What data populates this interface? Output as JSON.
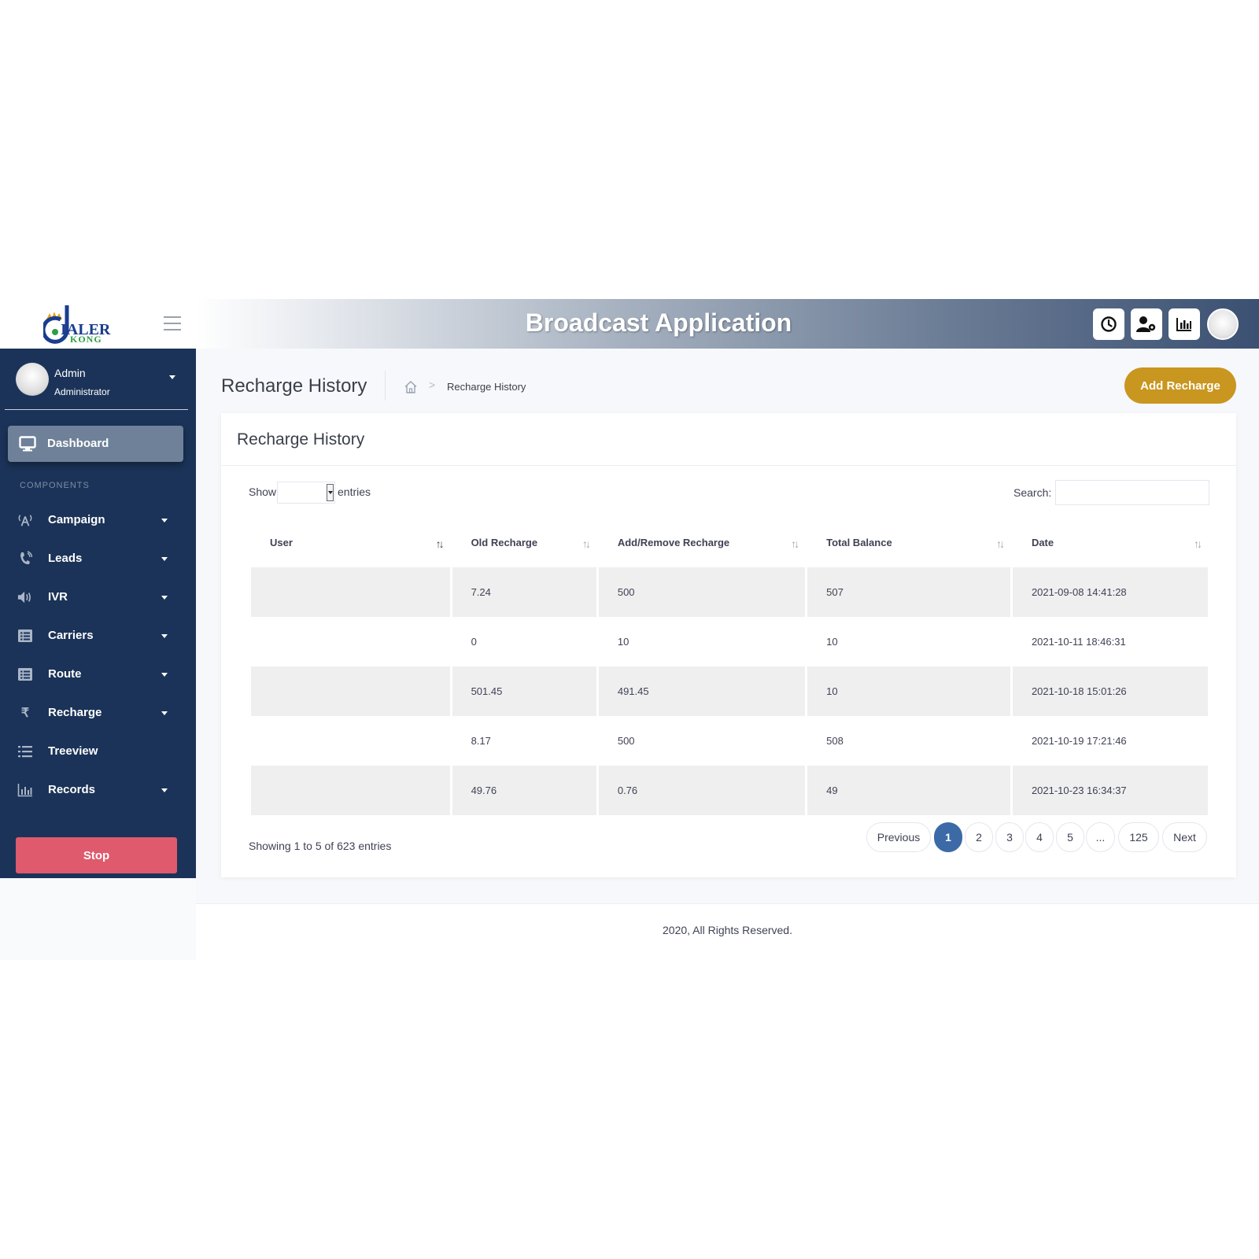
{
  "brand": {
    "logo_line1": "IALER",
    "logo_line2": "KONG"
  },
  "header": {
    "title": "Broadcast Application"
  },
  "sidebar": {
    "user": {
      "name": "Admin",
      "role": "Administrator"
    },
    "active_item": {
      "label": "Dashboard",
      "icon": "monitor-icon"
    },
    "section_label": "COMPONENTS",
    "items": [
      {
        "label": "Campaign",
        "icon": "antenna-icon"
      },
      {
        "label": "Leads",
        "icon": "phone-icon"
      },
      {
        "label": "IVR",
        "icon": "speaker-icon"
      },
      {
        "label": "Carriers",
        "icon": "list-box-icon"
      },
      {
        "label": "Route",
        "icon": "list-box-icon"
      },
      {
        "label": "Recharge",
        "icon": "rupee-icon"
      },
      {
        "label": "Treeview",
        "icon": "list-icon"
      },
      {
        "label": "Records",
        "icon": "bar-chart-icon"
      }
    ],
    "stop_label": "Stop"
  },
  "page": {
    "title": "Recharge History",
    "breadcrumb_current": "Recharge History",
    "add_button": "Add Recharge"
  },
  "card": {
    "title": "Recharge History",
    "show_label": "Show",
    "entries_label": "entries",
    "search_label": "Search:",
    "search_value": "",
    "columns": [
      "User",
      "Old Recharge",
      "Add/Remove Recharge",
      "Total Balance",
      "Date"
    ],
    "rows": [
      [
        "",
        "7.24",
        "500",
        "507",
        "2021-09-08 14:41:28"
      ],
      [
        "",
        "0",
        "10",
        "10",
        "2021-10-11 18:46:31"
      ],
      [
        "",
        "501.45",
        "491.45",
        "10",
        "2021-10-18 15:01:26"
      ],
      [
        "",
        "8.17",
        "500",
        "508",
        "2021-10-19 17:21:46"
      ],
      [
        "",
        "49.76",
        "0.76",
        "49",
        "2021-10-23 16:34:37"
      ]
    ],
    "info": "Showing 1 to 5 of 623 entries",
    "pagination": {
      "previous": "Previous",
      "pages": [
        "1",
        "2",
        "3",
        "4",
        "5",
        "...",
        "125"
      ],
      "active": "1",
      "next": "Next"
    }
  },
  "footer": {
    "text": "2020, All Rights Reserved."
  },
  "colors": {
    "sidebar": "#1b3358",
    "accent_button": "#c9961f",
    "stop_button": "#de5a6c",
    "active_page": "#3c6aa6"
  }
}
